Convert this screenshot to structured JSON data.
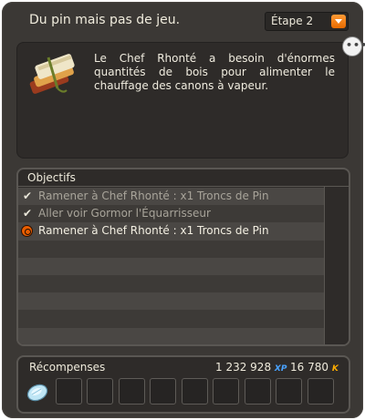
{
  "quest": {
    "title": "Du pin mais pas de jeu.",
    "step_label": "Étape 2",
    "description": "Le Chef Rhonté a besoin d'énormes quantités de bois pour alimenter le chauffage des canons à vapeur.",
    "more_label": "•••"
  },
  "objectives": {
    "title": "Objectifs",
    "items": [
      {
        "label": "Ramener à Chef Rhonté : x1 Troncs de Pin",
        "status": "done",
        "icon": "checkmark-icon"
      },
      {
        "label": "Aller voir Gormor l'Équarrisseur",
        "status": "done",
        "icon": "checkmark-icon"
      },
      {
        "label": "Ramener à Chef Rhonté : x1 Troncs de Pin",
        "status": "active",
        "icon": "active-target-icon"
      }
    ]
  },
  "rewards": {
    "title": "Récompenses",
    "xp": "1 232 928",
    "xp_unit": "XP",
    "kamas": "16 780",
    "kamas_unit": "K",
    "slots": [
      {
        "item": "crystal-item-icon"
      },
      {
        "item": ""
      },
      {
        "item": ""
      },
      {
        "item": ""
      },
      {
        "item": ""
      },
      {
        "item": ""
      },
      {
        "item": ""
      },
      {
        "item": ""
      },
      {
        "item": ""
      },
      {
        "item": ""
      }
    ]
  },
  "colors": {
    "panel_bg": "#3b3835",
    "accent_orange": "#f07a10",
    "xp_blue": "#4aa3ff",
    "kamas_gold": "#ffae00"
  }
}
